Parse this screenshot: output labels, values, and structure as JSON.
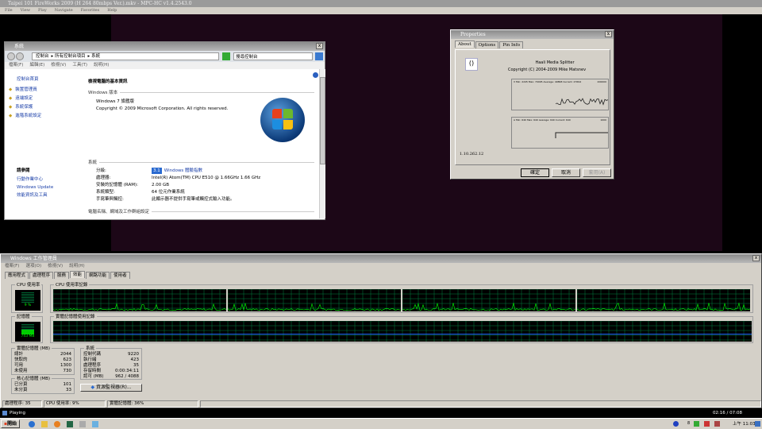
{
  "player": {
    "title": "Taipei 101 FireWorks 2009 (H 264 80mbps Ver.).mkv - MPC-HC v1.4.2543.0",
    "menu": [
      "File",
      "View",
      "Play",
      "Navigate",
      "Favorites",
      "Help"
    ],
    "status": "Playing",
    "time": "02:16 / 07:08"
  },
  "system_window": {
    "title": "系統",
    "breadcrumb": [
      "控制台",
      "所有控制台項目",
      "系統"
    ],
    "search_placeholder": "搜尋控制台",
    "menu": [
      "檔案(F)",
      "編輯(E)",
      "檢視(V)",
      "工具(T)",
      "說明(H)"
    ],
    "sidebar": {
      "home": "控制台首頁",
      "items": [
        "裝置管理員",
        "遠端設定",
        "系統保護",
        "進階系統設定"
      ],
      "see_also": "請參閱",
      "see_also_items": [
        "行動作業中心",
        "Windows Update",
        "效能資訊及工具"
      ]
    },
    "heading": "檢視電腦的基本資訊",
    "edition_section": "Windows 版本",
    "edition": "Windows 7 旗艦版",
    "copyright": "Copyright © 2009 Microsoft Corporation.  All rights reserved.",
    "system_section": "系統",
    "rows": [
      {
        "label": "分級:",
        "value": "Windows 體驗指數",
        "badge": "3.1"
      },
      {
        "label": "處理器:",
        "value": "Intel(R) Atom(TM) CPU E510   @ 1.66GHz   1.66 GHz"
      },
      {
        "label": "安裝的記憶體 (RAM):",
        "value": "2.00 GB"
      },
      {
        "label": "系統類型:",
        "value": "64 位元作業系統"
      },
      {
        "label": "手寫筆與觸控:",
        "value": "此顯示器不提供手寫筆或觸控式輸入功能。"
      }
    ],
    "computer_section": "電腦名稱、網域及工作群組設定"
  },
  "properties": {
    "title": "Properties",
    "tabs": [
      "About",
      "Options",
      "Pin Info"
    ],
    "product": "Haali Media Splitter",
    "copyright": "Copyright (C) 2004-2009 Mike Matsnev",
    "graph1": "V Min: 2245  Max: 70095  Average: 40868  Current: 27694",
    "graph1_max": "200000",
    "graph2": "A Min: 640  Max: 640  Average: 640  Current: 640",
    "graph2_max": "1000",
    "version": "1.10.262.12",
    "ok": "確定",
    "cancel": "取消",
    "apply": "套用(A)"
  },
  "taskmgr": {
    "title": "Windows 工作管理員",
    "menu": [
      "檔案(F)",
      "選項(O)",
      "檢視(V)",
      "說明(H)"
    ],
    "tabs": [
      "應用程式",
      "處理程序",
      "服務",
      "效能",
      "網路功能",
      "使用者"
    ],
    "active_tab": "效能",
    "cpu_usage_label": "CPU 使用率",
    "cpu_usage": "9 %",
    "cpu_history_label": "CPU 使用率記錄",
    "mem_label": "記憶體",
    "mem_value": "743 MB",
    "mem_history_label": "實體記憶體使用記錄",
    "physical": {
      "title": "實體記憶體 (MB)",
      "rows": [
        [
          "總計",
          "2044"
        ],
        [
          "快取的",
          "623"
        ],
        [
          "可用",
          "1300"
        ],
        [
          "未使用",
          "730"
        ]
      ]
    },
    "kernel": {
      "title": "核心記憶體 (MB)",
      "rows": [
        [
          "已分頁",
          "101"
        ],
        [
          "未分頁",
          "33"
        ]
      ]
    },
    "system": {
      "title": "系統",
      "rows": [
        [
          "控制代碼",
          "9220"
        ],
        [
          "執行緒",
          "423"
        ],
        [
          "處理程序",
          "35"
        ],
        [
          "存留時間",
          "0:00:34:11"
        ],
        [
          "認可 (MB)",
          "962 / 4088"
        ]
      ]
    },
    "resmon": "資源監視器(R)...",
    "status": [
      "處理程序: 35",
      "CPU 使用率: 9%",
      "實體記憶體: 36%"
    ],
    "cpu_percent": 9,
    "mem_percent": 36
  },
  "taskbar": {
    "start": "開始",
    "clock": "上午 11:03",
    "tray_num": "8"
  },
  "colors": {
    "graph_bg": "#000000",
    "graph_grid": "#008040",
    "graph_line": "#00ff00",
    "mem_line": "#2060ff",
    "link": "#1a3fa8"
  }
}
